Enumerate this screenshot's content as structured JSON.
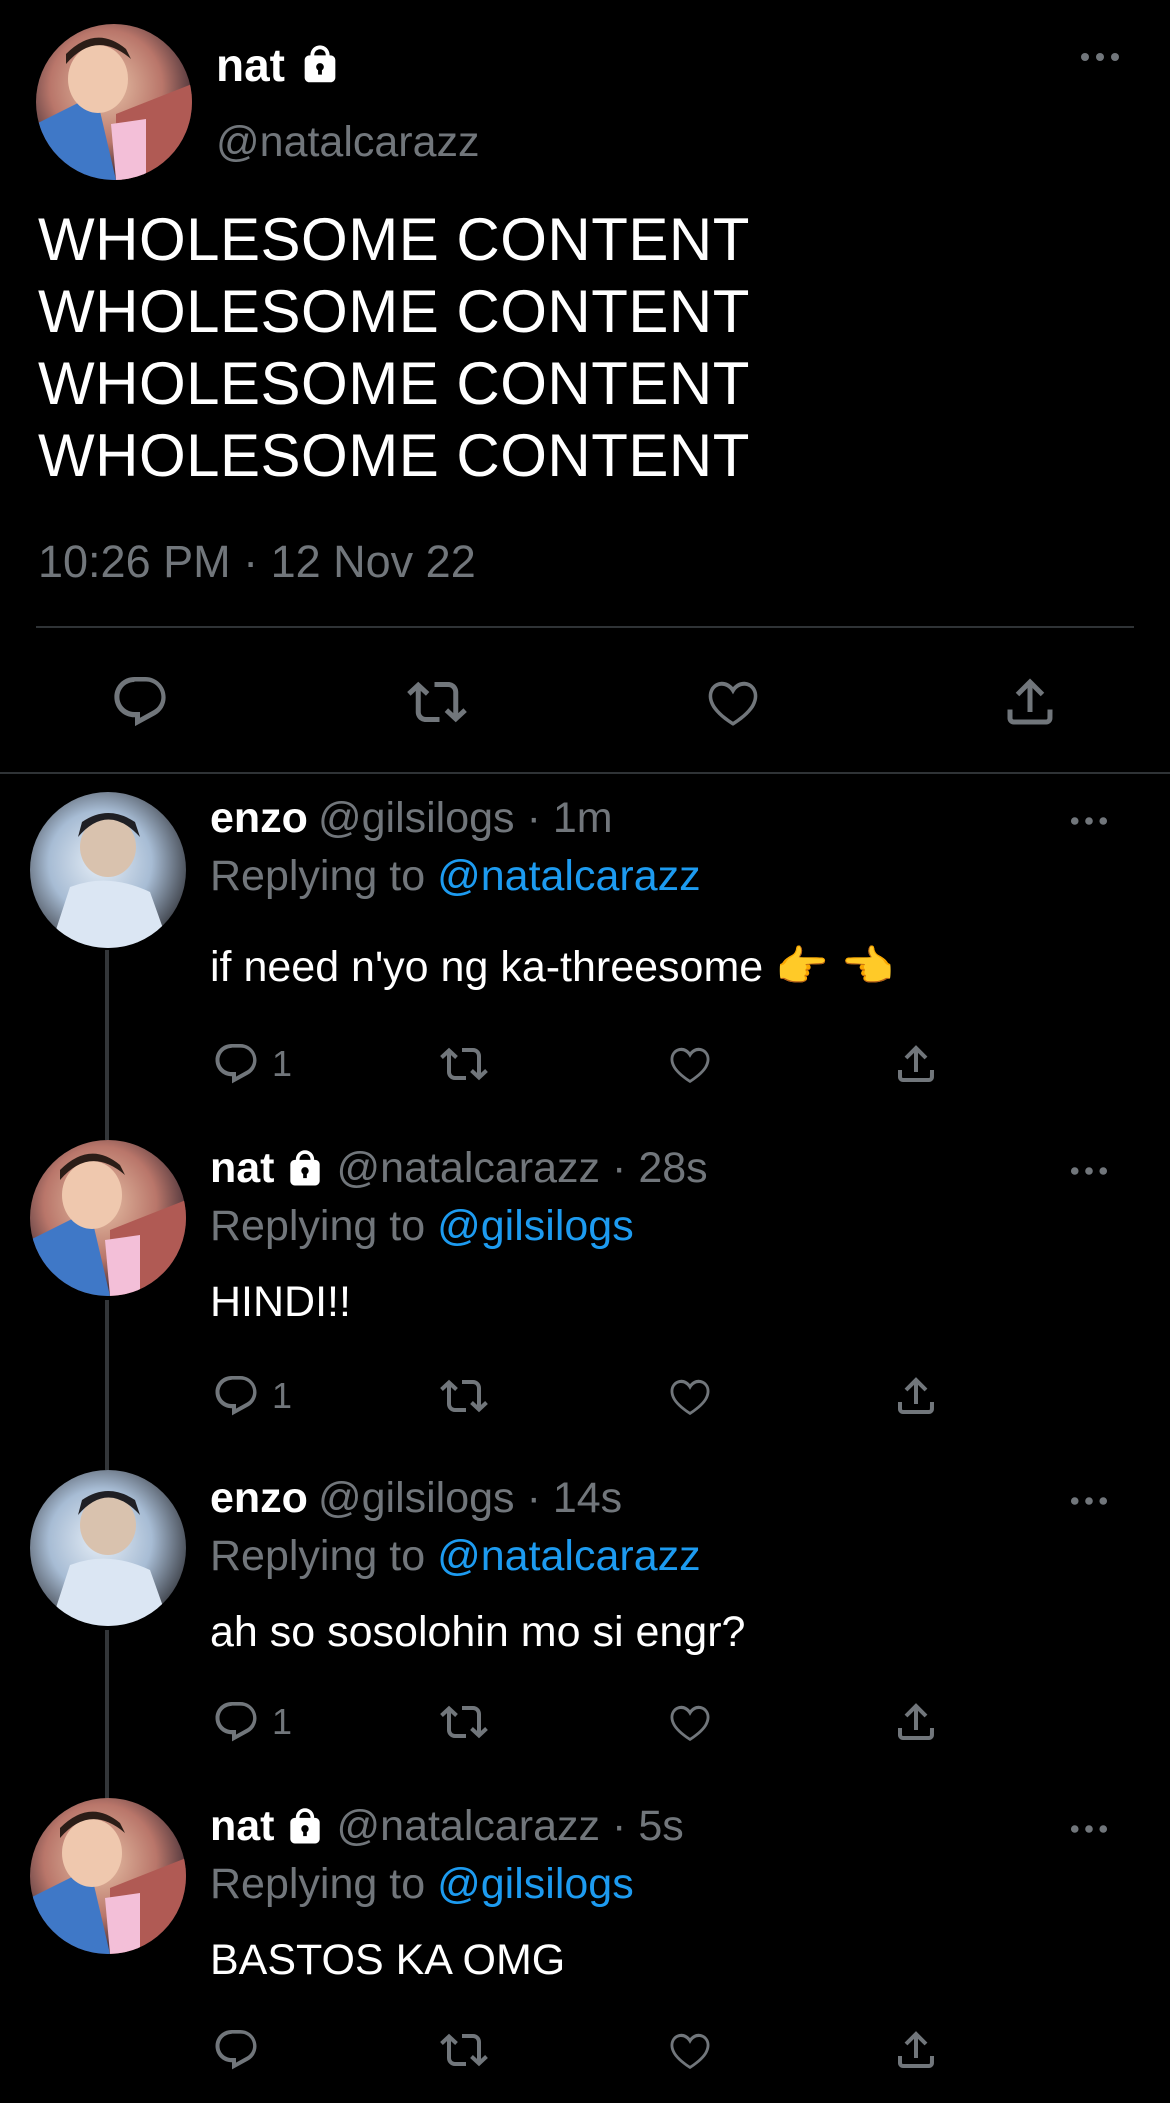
{
  "main_tweet": {
    "name": "nat",
    "handle": "@natalcarazz",
    "text_lines": [
      "WHOLESOME CONTENT",
      "WHOLESOME CONTENT",
      "WHOLESOME CONTENT",
      "WHOLESOME CONTENT"
    ],
    "timestamp": "10:26 PM · 12 Nov 22"
  },
  "replies": [
    {
      "name": "enzo",
      "locked": false,
      "handle": "@gilsilogs",
      "time": "· 1m",
      "replying_label": "Replying to",
      "replying_to": "@natalcarazz",
      "text": " if need n'yo ng ka-threesome 👉 👈",
      "reply_count": "1"
    },
    {
      "name": "nat",
      "locked": true,
      "handle": "@natalcarazz",
      "time": "· 28s",
      "replying_label": "Replying to",
      "replying_to": "@gilsilogs",
      "text": "HINDI!!",
      "reply_count": "1"
    },
    {
      "name": "enzo",
      "locked": false,
      "handle": "@gilsilogs",
      "time": "· 14s",
      "replying_label": "Replying to",
      "replying_to": "@natalcarazz",
      "text": "ah so sosolohin mo si engr?",
      "reply_count": "1"
    },
    {
      "name": "nat",
      "locked": true,
      "handle": "@natalcarazz",
      "time": "· 5s",
      "replying_label": "Replying to",
      "replying_to": "@gilsilogs",
      "text": "BASTOS KA OMG",
      "reply_count": ""
    }
  ],
  "colors": {
    "background": "#000000",
    "text": "#e7e9ea",
    "secondary": "#71767b",
    "link": "#1d9bf0"
  },
  "icons": [
    "lock-icon",
    "more-icon",
    "reply-icon",
    "retweet-icon",
    "like-icon",
    "share-icon"
  ]
}
